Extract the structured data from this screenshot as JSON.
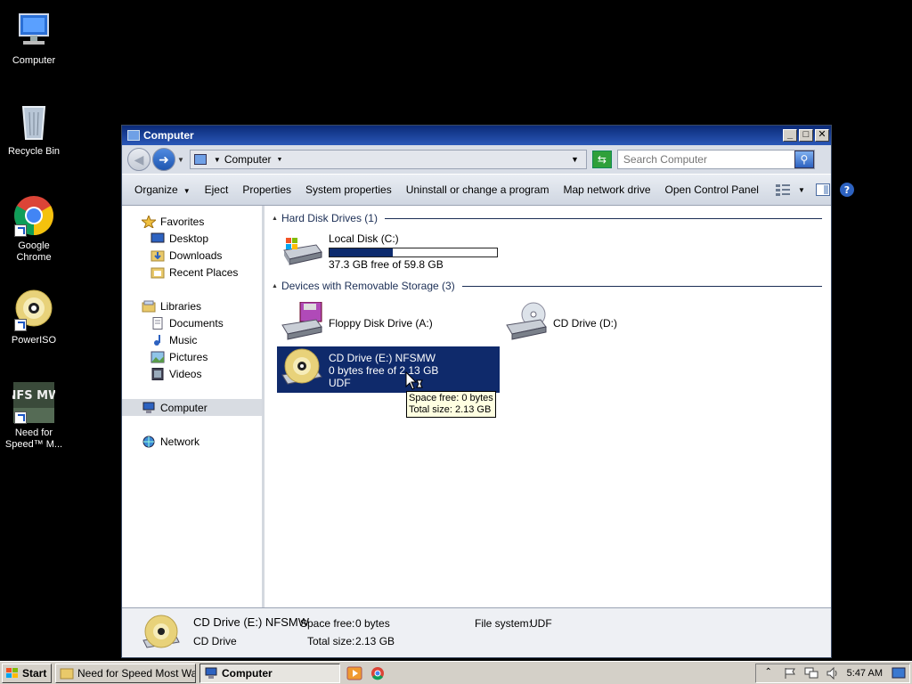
{
  "desktop": {
    "icons": [
      {
        "label": "Computer"
      },
      {
        "label": "Recycle Bin"
      },
      {
        "label": "Google Chrome"
      },
      {
        "label": "PowerISO"
      },
      {
        "label": "Need for Speed™ M...",
        "badge": "NFS MW"
      }
    ]
  },
  "window": {
    "title": "Computer",
    "controls": {
      "minimize": "_",
      "maximize": "□",
      "close": "✕"
    }
  },
  "address": {
    "crumb": "Computer",
    "search_placeholder": "Search Computer"
  },
  "toolbar": {
    "items": [
      "Organize",
      "Eject",
      "Properties",
      "System properties",
      "Uninstall or change a program",
      "Map network drive",
      "Open Control Panel"
    ]
  },
  "nav": {
    "favorites": "Favorites",
    "favorites_items": [
      "Desktop",
      "Downloads",
      "Recent Places"
    ],
    "libraries": "Libraries",
    "libraries_items": [
      "Documents",
      "Music",
      "Pictures",
      "Videos"
    ],
    "computer": "Computer",
    "network": "Network"
  },
  "groups": {
    "hard_disks": "Hard Disk Drives (1)",
    "removable": "Devices with Removable Storage (3)"
  },
  "drives": {
    "c": {
      "name": "Local Disk (C:)",
      "free": "37.3 GB free of 59.8 GB",
      "used_fraction": 0.376
    },
    "a": {
      "name": "Floppy Disk Drive (A:)"
    },
    "d": {
      "name": "CD Drive (D:)"
    },
    "e": {
      "name": "CD Drive (E:) NFSMW",
      "free": "0 bytes free of 2.13 GB",
      "fs": "UDF"
    }
  },
  "tooltip": {
    "line1": "Space free: 0 bytes",
    "line2": "Total size: 2.13 GB"
  },
  "details": {
    "name": "CD Drive (E:) NFSMW",
    "type": "CD Drive",
    "space_free_label": "Space free:",
    "space_free": "0 bytes",
    "total_size_label": "Total size:",
    "total_size": "2.13 GB",
    "fs_label": "File system:",
    "fs": "UDF"
  },
  "taskbar": {
    "start": "Start",
    "tasks": [
      "Need for Speed Most Wa...",
      "Computer"
    ],
    "clock": "5:47 AM"
  },
  "colors": {
    "selection": "#0f2a6b",
    "title_gradient": [
      "#0b2a78",
      "#2a58b8"
    ],
    "desktop": "#000000"
  }
}
